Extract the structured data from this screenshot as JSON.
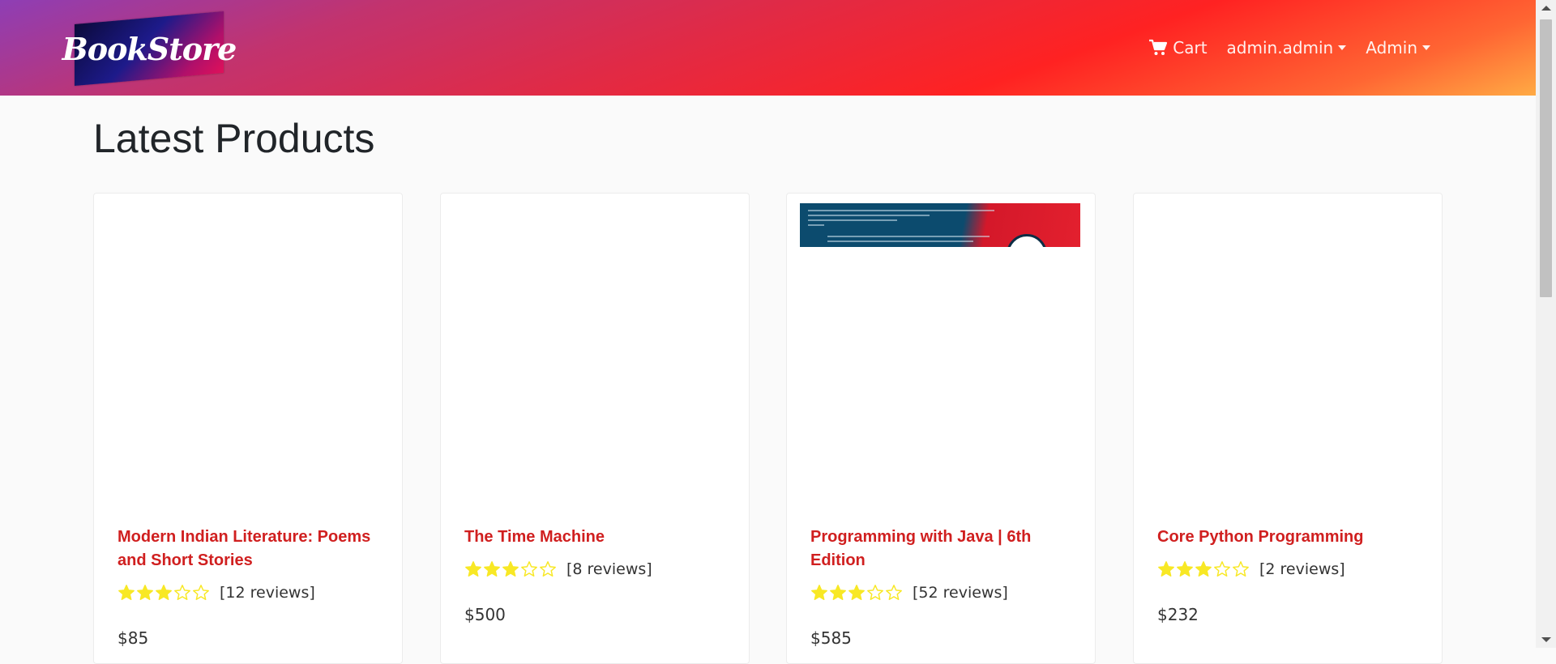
{
  "navbar": {
    "logo_text": "BookStore",
    "cart_label": "Cart",
    "user_menu_label": "admin.admin",
    "admin_menu_label": "Admin"
  },
  "page_title": "Latest Products",
  "products": [
    {
      "title": "Modern Indian Literature: Poems and Short Stories",
      "rating": 3,
      "reviews": "[12 reviews]",
      "price": "$85"
    },
    {
      "title": "The Time Machine",
      "rating": 3,
      "reviews": "[8 reviews]",
      "price": "$500"
    },
    {
      "title": "Programming with Java | 6th Edition",
      "rating": 3,
      "reviews": "[52 reviews]",
      "price": "$585"
    },
    {
      "title": "Core Python Programming",
      "rating": 3,
      "reviews": "[2 reviews]",
      "price": "$232"
    }
  ],
  "colors": {
    "title_link": "#d01f1f",
    "star_filled": "#f8e825"
  }
}
